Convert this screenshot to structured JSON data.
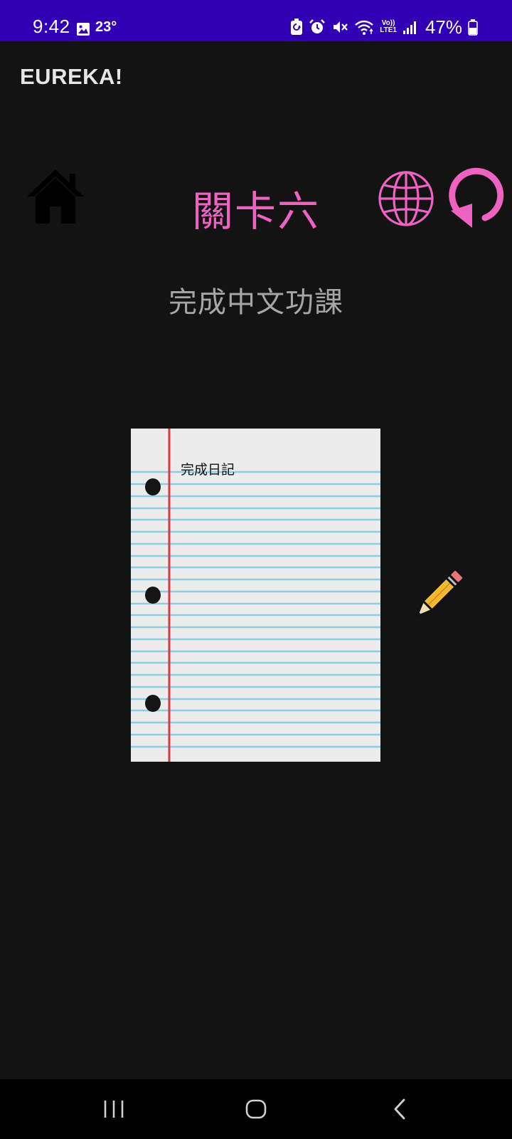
{
  "status_bar": {
    "time": "9:42",
    "temperature": "23°",
    "battery_percent": "47%",
    "network_label_top": "Vo))",
    "network_label_bottom": "LTE1",
    "icons": [
      "photo-icon",
      "battery-saver-icon",
      "alarm-icon",
      "mute-icon",
      "wifi-icon",
      "signal-icon",
      "battery-icon"
    ]
  },
  "app_bar": {
    "title": "EUREKA!"
  },
  "toolbar": {
    "level_title": "關卡六",
    "home_icon": "home-icon",
    "language_icon": "globe-icon",
    "restart_icon": "restart-icon"
  },
  "content": {
    "subtitle": "完成中文功課",
    "notebook_text": "完成日記",
    "pencil_icon": "pencil-icon"
  },
  "nav_bar": {
    "icons": [
      "recents-icon",
      "home-nav-icon",
      "back-icon"
    ]
  },
  "colors": {
    "status_bar_bg": "#3200b4",
    "background": "#131313",
    "accent_pink": "#f062c0",
    "subtitle_gray": "#a6a6a6",
    "paper": "#ececec",
    "paper_line": "#8ecfdf",
    "margin_line": "#d23c3c"
  }
}
